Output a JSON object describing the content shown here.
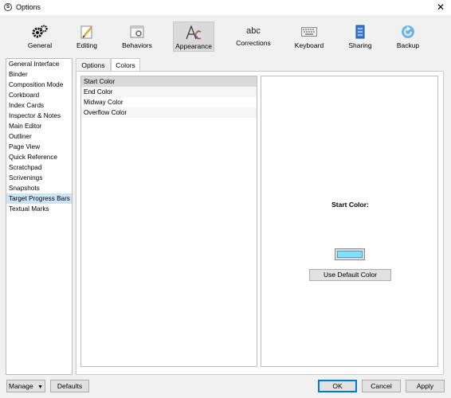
{
  "window": {
    "title": "Options",
    "app_icon_letter": "S"
  },
  "toolbar": {
    "items": [
      {
        "label": "General",
        "icon": "gear-icon"
      },
      {
        "label": "Editing",
        "icon": "pencil-paper-icon"
      },
      {
        "label": "Behaviors",
        "icon": "behaviors-window-icon"
      },
      {
        "label": "Appearance",
        "icon": "font-color-icon",
        "active": true
      },
      {
        "label": "Corrections",
        "icon": "abc-icon"
      },
      {
        "label": "Keyboard",
        "icon": "keyboard-icon"
      },
      {
        "label": "Sharing",
        "icon": "sharing-icon"
      },
      {
        "label": "Backup",
        "icon": "backup-icon"
      }
    ],
    "abc_text": "abc"
  },
  "sidebar": {
    "items": [
      "General Interface",
      "Binder",
      "Composition Mode",
      "Corkboard",
      "Index Cards",
      "Inspector & Notes",
      "Main Editor",
      "Outliner",
      "Page View",
      "Quick Reference",
      "Scratchpad",
      "Scrivenings",
      "Snapshots",
      "Target Progress Bars",
      "Textual Marks"
    ],
    "selected": "Target Progress Bars"
  },
  "tabs": {
    "options": "Options",
    "colors": "Colors",
    "active": "Colors"
  },
  "color_list": {
    "items": [
      "Start Color",
      "End Color",
      "Midway Color",
      "Overflow Color"
    ],
    "selected": "Start Color"
  },
  "detail": {
    "title": "Start Color:",
    "swatch_color": "#80e0ff",
    "default_button": "Use Default Color"
  },
  "bottom": {
    "manage": "Manage",
    "defaults": "Defaults",
    "ok": "OK",
    "cancel": "Cancel",
    "apply": "Apply"
  },
  "colors": {
    "accent": "#0078d7",
    "selection": "#cce4f7"
  }
}
